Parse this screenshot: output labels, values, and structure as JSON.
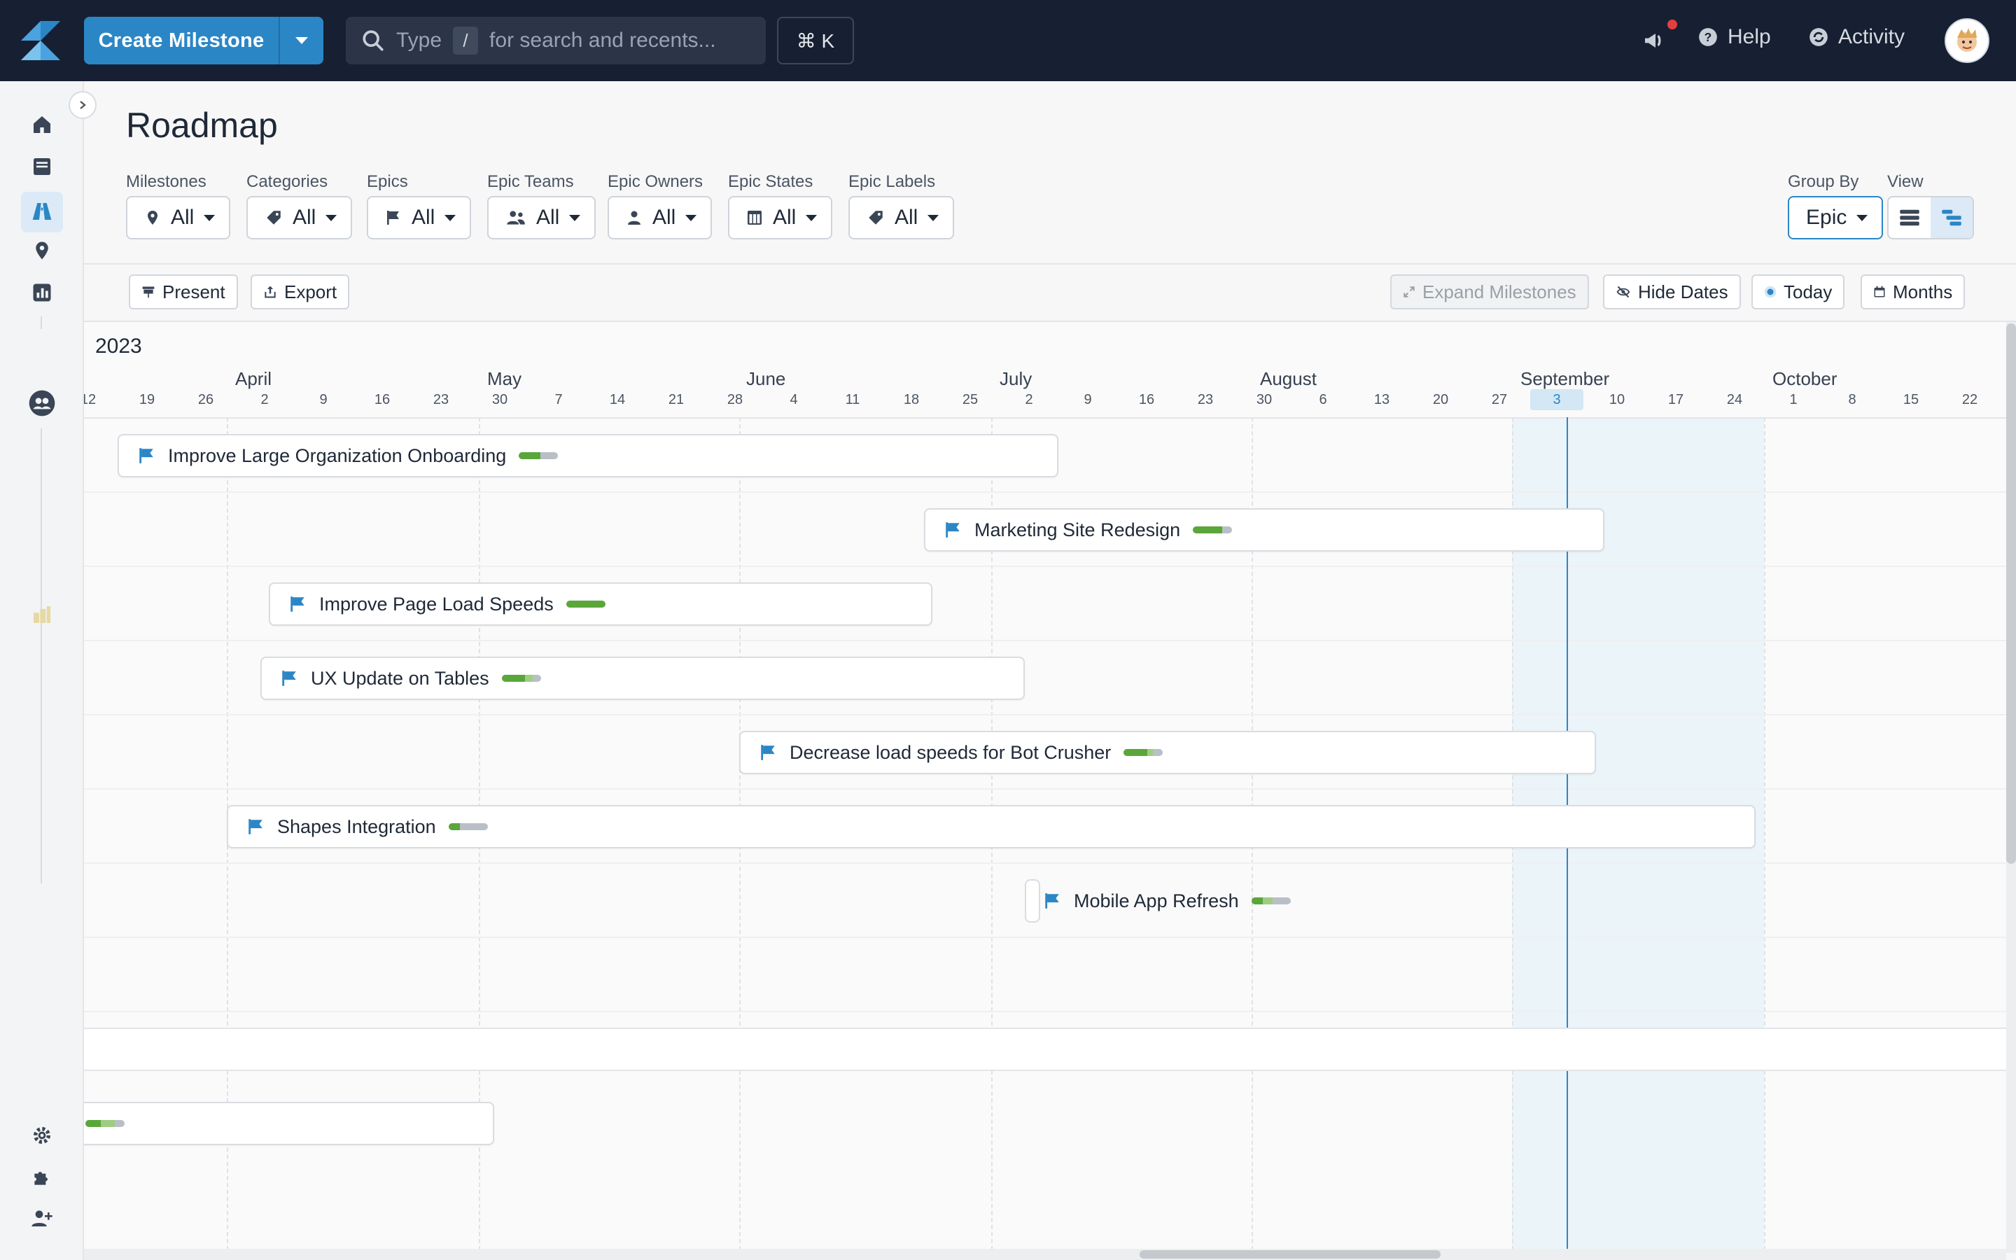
{
  "topbar": {
    "create_label": "Create Milestone",
    "search_prefix": "Type",
    "search_key": "/",
    "search_suffix": "for search and recents...",
    "shortcut": "⌘ K",
    "help_label": "Help",
    "activity_label": "Activity"
  },
  "page": {
    "title": "Roadmap"
  },
  "filters": [
    {
      "label": "Milestones",
      "value": "All",
      "icon": "map-pin-icon"
    },
    {
      "label": "Categories",
      "value": "All",
      "icon": "tag-icon"
    },
    {
      "label": "Epics",
      "value": "All",
      "icon": "flag-icon"
    },
    {
      "label": "Epic Teams",
      "value": "All",
      "icon": "team-icon"
    },
    {
      "label": "Epic Owners",
      "value": "All",
      "icon": "person-icon"
    },
    {
      "label": "Epic States",
      "value": "All",
      "icon": "columns-icon"
    },
    {
      "label": "Epic Labels",
      "value": "All",
      "icon": "tag-icon"
    }
  ],
  "group_by": {
    "label": "Group By",
    "value": "Epic"
  },
  "view": {
    "label": "View",
    "options": [
      "list-view-icon",
      "timeline-view-icon"
    ],
    "active": "timeline-view-icon"
  },
  "toolbar": {
    "present": "Present",
    "export": "Export",
    "expand_milestones": "Expand Milestones",
    "hide_dates": "Hide Dates",
    "today": "Today",
    "months": "Months"
  },
  "timeline": {
    "year": "2023",
    "months": [
      "April",
      "May",
      "June",
      "July",
      "August",
      "September",
      "October"
    ],
    "weeks": [
      "12",
      "19",
      "26",
      "2",
      "9",
      "16",
      "23",
      "30",
      "7",
      "14",
      "21",
      "28",
      "4",
      "11",
      "18",
      "25",
      "2",
      "9",
      "16",
      "23",
      "30",
      "6",
      "13",
      "20",
      "27",
      "3",
      "10",
      "17",
      "24",
      "1",
      "8",
      "15",
      "22"
    ],
    "today_week": "3"
  },
  "epics": [
    {
      "name": "Improve Large Organization Onboarding",
      "done": 0.55,
      "in_progress": 0.0
    },
    {
      "name": "Marketing Site Redesign",
      "done": 0.75,
      "in_progress": 0.0
    },
    {
      "name": "Improve Page Load Speeds",
      "done": 1.0,
      "in_progress": 0.0
    },
    {
      "name": "UX Update on Tables",
      "done": 0.6,
      "in_progress": 0.2
    },
    {
      "name": "Decrease load speeds for Bot Crusher",
      "done": 0.6,
      "in_progress": 0.15
    },
    {
      "name": "Shapes Integration",
      "done": 0.3,
      "in_progress": 0.0
    },
    {
      "name": "Mobile App Refresh",
      "done": 0.3,
      "in_progress": 0.25
    }
  ],
  "colors": {
    "accent": "#2b86c6",
    "topbar": "#172032",
    "progress_done": "#5aa63a",
    "progress_in_progress": "#9ecd81",
    "notification": "#e53e3e"
  }
}
